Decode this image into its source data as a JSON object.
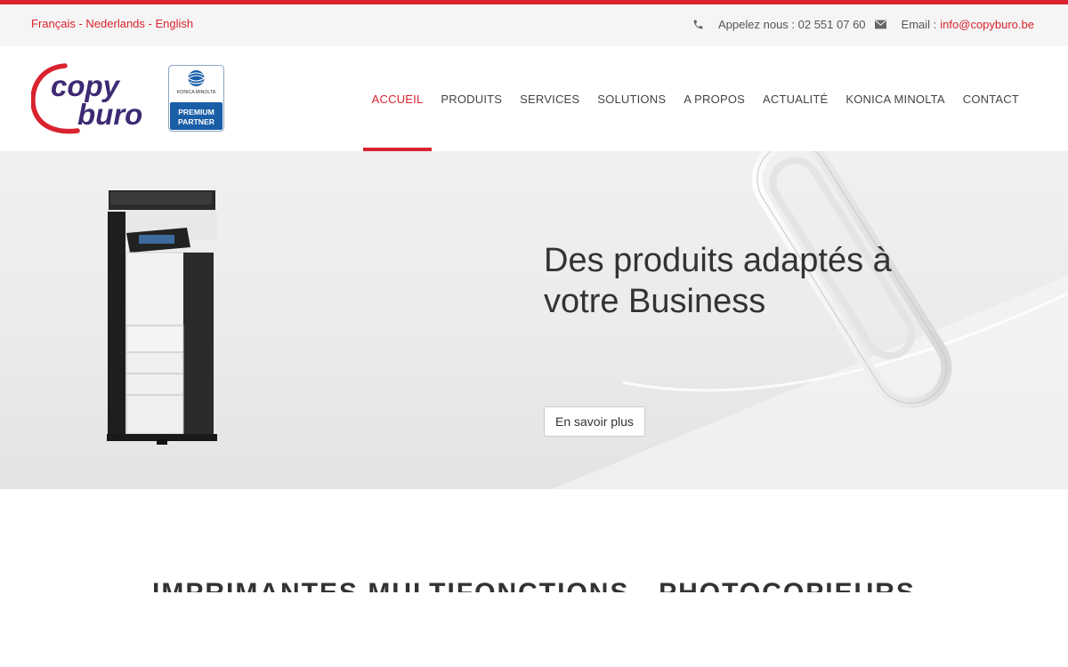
{
  "colors": {
    "accent": "#d9232e",
    "logo_purple": "#3d2a73",
    "partner_blue": "#1a5ea8"
  },
  "topbar": {
    "languages": [
      "Français",
      "Nederlands",
      "English"
    ],
    "separator": " - ",
    "phone_icon": "phone-icon",
    "phone_text": "Appelez nous : 02 551 07 60",
    "email_icon": "envelope-icon",
    "email_label": "Email :",
    "email_address": "info@copyburo.be"
  },
  "logo": {
    "line1": "copy",
    "line2": "buro"
  },
  "partner_badge": {
    "brand": "KONICA MINOLTA",
    "line1": "PREMIUM",
    "line2": "PARTNER"
  },
  "nav": {
    "items": [
      {
        "label": "ACCUEIL",
        "active": true
      },
      {
        "label": "PRODUITS",
        "active": false
      },
      {
        "label": "SERVICES",
        "active": false
      },
      {
        "label": "SOLUTIONS",
        "active": false
      },
      {
        "label": "A PROPOS",
        "active": false
      },
      {
        "label": "ACTUALITÉ",
        "active": false
      },
      {
        "label": "KONICA MINOLTA",
        "active": false
      },
      {
        "label": "CONTACT",
        "active": false
      }
    ]
  },
  "hero": {
    "title": "Des produits adaptés à votre Business",
    "button_label": "En savoir plus"
  },
  "section": {
    "title": "IMPRIMANTES MULTIFONCTIONS - PHOTOCOPIEURS"
  }
}
